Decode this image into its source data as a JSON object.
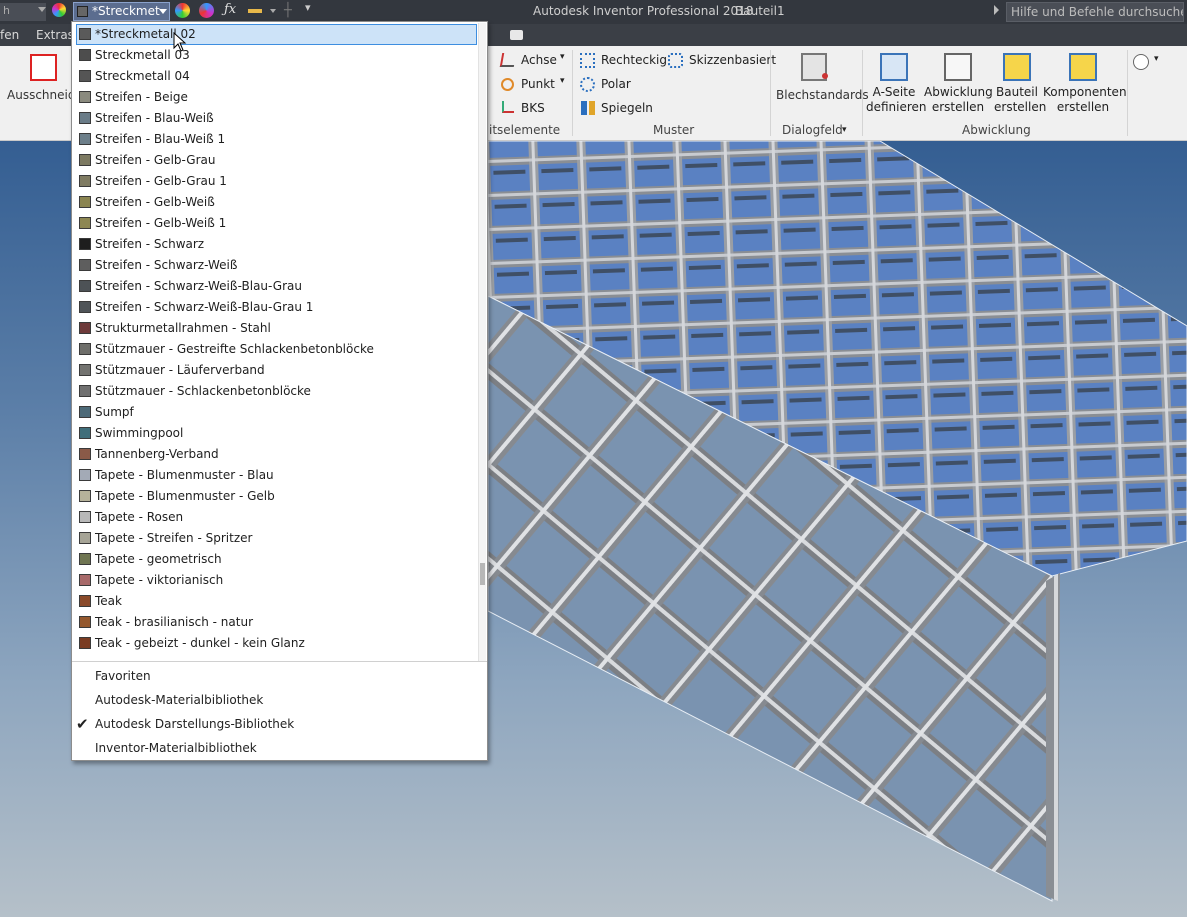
{
  "titlebar": {
    "left_combo": "h",
    "style_combo": "*Streckmet",
    "app_title": "Autodesk Inventor Professional 2018",
    "doc_title": "Bauteil1",
    "search_placeholder": "Hilfe und Befehle durchsuchen..."
  },
  "menu_tabs": [
    "fen",
    "Extras"
  ],
  "ribbon": {
    "ausschneiden": "Ausschneide",
    "achse": "Achse",
    "punkt": "Punkt",
    "bks": "BKS",
    "arbeitselemente_group": "itselemente",
    "rechteckig": "Rechteckig",
    "skizzenbasiert": "Skizzenbasiert",
    "polar": "Polar",
    "spiegeln": "Spiegeln",
    "muster_group": "Muster",
    "blechstandards": "Blechstandards",
    "dialogfeld_group": "Dialogfeld",
    "a_seite_1": "A-Seite",
    "a_seite_2": "definieren",
    "abwicklung_1": "Abwicklung",
    "abwicklung_2": "erstellen",
    "bauteil_1": "Bauteil",
    "bauteil_2": "erstellen",
    "komponenten_1": "Komponenten",
    "komponenten_2": "erstellen",
    "abwicklung_group": "Abwicklung"
  },
  "dropdown": {
    "items": [
      {
        "label": "*Streckmetall 02",
        "color": "#5a5a5a",
        "selected": true
      },
      {
        "label": "Streckmetall 03",
        "color": "#4d4d4d"
      },
      {
        "label": "Streckmetall 04",
        "color": "#555555"
      },
      {
        "label": "Streifen - Beige",
        "color": "#8a8a7e"
      },
      {
        "label": "Streifen - Blau-Weiß",
        "color": "#6a7c88"
      },
      {
        "label": "Streifen - Blau-Weiß 1",
        "color": "#6d7f8a"
      },
      {
        "label": "Streifen - Gelb-Grau",
        "color": "#7d7a62"
      },
      {
        "label": "Streifen - Gelb-Grau 1",
        "color": "#7f7b62"
      },
      {
        "label": "Streifen - Gelb-Weiß",
        "color": "#8a8450"
      },
      {
        "label": "Streifen - Gelb-Weiß 1",
        "color": "#8d8752"
      },
      {
        "label": "Streifen - Schwarz",
        "color": "#1e1e1e"
      },
      {
        "label": "Streifen - Schwarz-Weiß",
        "color": "#5e5e5e"
      },
      {
        "label": "Streifen - Schwarz-Weiß-Blau-Grau",
        "color": "#4d5256"
      },
      {
        "label": "Streifen - Schwarz-Weiß-Blau-Grau 1",
        "color": "#4f5458"
      },
      {
        "label": "Strukturmetallrahmen - Stahl",
        "color": "#6e3a3a"
      },
      {
        "label": "Stützmauer - Gestreifte Schlackenbetonblöcke",
        "color": "#6e6e6a"
      },
      {
        "label": "Stützmauer - Läuferverband",
        "color": "#737370"
      },
      {
        "label": "Stützmauer - Schlackenbetonblöcke",
        "color": "#707070"
      },
      {
        "label": "Sumpf",
        "color": "#4d6a78"
      },
      {
        "label": "Swimmingpool",
        "color": "#3f6e7a"
      },
      {
        "label": "Tannenberg-Verband",
        "color": "#8a5a48"
      },
      {
        "label": "Tapete - Blumenmuster - Blau",
        "color": "#a3aab6"
      },
      {
        "label": "Tapete - Blumenmuster - Gelb",
        "color": "#b6b29a"
      },
      {
        "label": "Tapete - Rosen",
        "color": "#b8b8b8"
      },
      {
        "label": "Tapete - Streifen - Spritzer",
        "color": "#a6a496"
      },
      {
        "label": "Tapete - geometrisch",
        "color": "#6f7552"
      },
      {
        "label": "Tapete - viktorianisch",
        "color": "#a86a6a"
      },
      {
        "label": "Teak",
        "color": "#8a4a2a"
      },
      {
        "label": "Teak - brasilianisch - natur",
        "color": "#94582e"
      },
      {
        "label": "Teak - gebeizt - dunkel - kein Glanz",
        "color": "#7a3c22"
      }
    ],
    "libraries": [
      {
        "label": "Favoriten",
        "checked": false
      },
      {
        "label": "Autodesk-Materialbibliothek",
        "checked": false
      },
      {
        "label": "Autodesk Darstellungs-Bibliothek",
        "checked": true
      },
      {
        "label": "Inventor-Materialbibliothek",
        "checked": false
      }
    ],
    "check_glyph": "✔"
  },
  "colors": {
    "titlebar": "#33373e",
    "selection": "#cde3f8",
    "selection_border": "#3d8ee0",
    "viewport_top": "#345e92"
  }
}
